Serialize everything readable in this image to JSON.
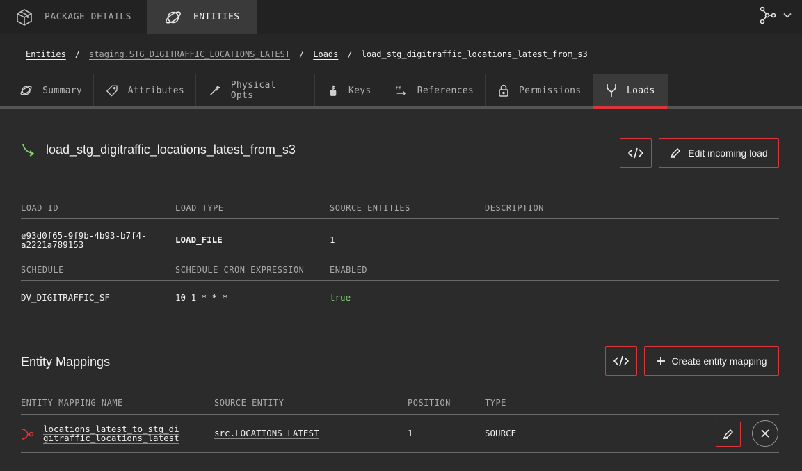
{
  "topnav": {
    "package_details": "PACKAGE DETAILS",
    "entities": "ENTITIES"
  },
  "breadcrumb": {
    "root": "Entities",
    "entity": "staging.STG_DIGITRAFFIC_LOCATIONS_LATEST",
    "section": "Loads",
    "current": "load_stg_digitraffic_locations_latest_from_s3"
  },
  "tabs": [
    {
      "label": "Summary",
      "icon": "planet-icon"
    },
    {
      "label": "Attributes",
      "icon": "tag-icon"
    },
    {
      "label": "Physical Opts",
      "icon": "wrench-icon"
    },
    {
      "label": "Keys",
      "icon": "key-icon"
    },
    {
      "label": "References",
      "icon": "fk-icon"
    },
    {
      "label": "Permissions",
      "icon": "lock-icon"
    },
    {
      "label": "Loads",
      "icon": "merge-icon",
      "active": true
    }
  ],
  "load": {
    "name": "load_stg_digitraffic_locations_latest_from_s3",
    "edit_label": "Edit incoming load",
    "headers": {
      "load_id": "LOAD ID",
      "load_type": "LOAD TYPE",
      "source_entities": "SOURCE ENTITIES",
      "description": "DESCRIPTION",
      "schedule": "SCHEDULE",
      "cron": "SCHEDULE CRON EXPRESSION",
      "enabled": "ENABLED"
    },
    "load_id_line1": "e93d0f65-9f9b-4b93-b7f4-",
    "load_id_line2": "a2221a789153",
    "load_type": "LOAD_FILE",
    "source_entities": "1",
    "description": "",
    "schedule": "DV_DIGITRAFFIC_SF",
    "cron": "10 1 * * *",
    "enabled": "true"
  },
  "mappings": {
    "title": "Entity Mappings",
    "create_label": "Create entity mapping",
    "headers": {
      "name": "ENTITY MAPPING NAME",
      "source": "SOURCE ENTITY",
      "position": "POSITION",
      "type": "TYPE"
    },
    "rows": [
      {
        "name_line1": "locations_latest_to_stg_di",
        "name_line2": "gitraffic_locations_latest",
        "source": "src.LOCATIONS_LATEST",
        "position": "1",
        "type": "SOURCE"
      }
    ]
  },
  "colors": {
    "accent": "#d9373a",
    "enabled_green": "#7fcf6b"
  }
}
